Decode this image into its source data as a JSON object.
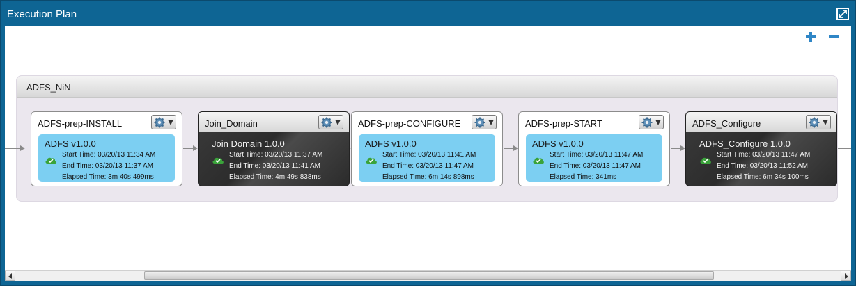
{
  "window": {
    "title": "Execution Plan"
  },
  "zoom": {
    "in_icon": "plus-icon",
    "out_icon": "minus-icon"
  },
  "group": {
    "name": "ADFS_NiN"
  },
  "colors": {
    "titlebar": "#0e6594",
    "success_card": "#7ccff2",
    "accent": "#2f86c6",
    "ok_icon": "#3aa33a"
  },
  "steps": [
    {
      "title": "ADFS-prep-INSTALL",
      "component": "ADFS v1.0.0",
      "status_icon": "success-cloud-icon",
      "start": "Start Time: 03/20/13 11:34 AM",
      "end": "End Time: 03/20/13 11:37 AM",
      "elapsed": "Elapsed Time: 3m 40s 499ms",
      "theme": "light"
    },
    {
      "title": "Join_Domain",
      "component": "Join Domain 1.0.0",
      "status_icon": "success-cloud-icon",
      "start": "Start Time: 03/20/13 11:37 AM",
      "end": "End Time: 03/20/13 11:41 AM",
      "elapsed": "Elapsed Time: 4m 49s 838ms",
      "theme": "dark"
    },
    {
      "title": "ADFS-prep-CONFIGURE",
      "component": "ADFS v1.0.0",
      "status_icon": "success-cloud-icon",
      "start": "Start Time: 03/20/13 11:41 AM",
      "end": "End Time: 03/20/13 11:47 AM",
      "elapsed": "Elapsed Time: 6m 14s 898ms",
      "theme": "light"
    },
    {
      "title": "ADFS-prep-START",
      "component": "ADFS v1.0.0",
      "status_icon": "success-cloud-icon",
      "start": "Start Time: 03/20/13 11:47 AM",
      "end": "End Time: 03/20/13 11:47 AM",
      "elapsed": "Elapsed Time: 341ms",
      "theme": "light"
    },
    {
      "title": "ADFS_Configure",
      "component": "ADFS_Configure 1.0.0",
      "status_icon": "success-cloud-icon",
      "start": "Start Time: 03/20/13 11:47 AM",
      "end": "End Time: 03/20/13 11:52 AM",
      "elapsed": "Elapsed Time: 6m 34s 100ms",
      "theme": "dark"
    }
  ]
}
